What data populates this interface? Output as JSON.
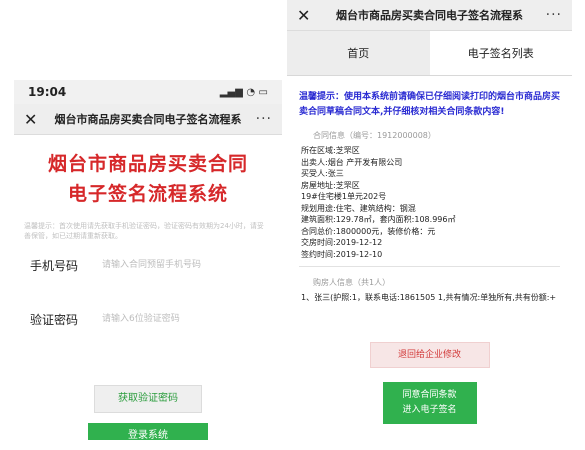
{
  "left": {
    "status_time": "19:04",
    "window_title": "烟台市商品房买卖合同电子签名流程系",
    "hero_line1": "烟台市商品房买卖合同",
    "hero_line2": "电子签名流程系统",
    "tip": "温馨提示：首次使用请先获取手机验证密码，验证密码有效期为24小时，请妥善保管，如已过期请重新获取。",
    "phone_label": "手机号码",
    "phone_placeholder": "请输入合同预留手机号码",
    "code_label": "验证密码",
    "code_placeholder": "请输入6位验证密码",
    "get_code_button": "获取验证密码",
    "login_button": "登录系统"
  },
  "right": {
    "window_title": "烟台市商品房买卖合同电子签名流程系",
    "tab_home": "首页",
    "tab_list": "电子签名列表",
    "warning": "温馨提示：使用本系统前请确保已仔细阅读打印的烟台市商品房买卖合同草稿合同文本,并仔细核对相关合同条款内容!",
    "contract_header": "合同信息（编号：1912000008）",
    "contract_lines": [
      "所在区域:芝罘区",
      "出卖人:烟台                产开发有限公司",
      "买受人:张三",
      "房屋地址:芝罘区",
      "19#住宅楼1单元202号",
      "规划用途:住宅、建筑结构：钢混",
      "建筑面积:129.78㎡，套内面积:108.996㎡",
      "合同总价:1800000元，装修价格：元",
      "交房时间:2019-12-12",
      "签约时间:2019-12-10"
    ],
    "buyer_header": "购房人信息（共1人）",
    "buyer_text": "1、张三(护照:1，联系电话:1861505        1,共有情况:单独所有,共有份额:+",
    "return_button": "退回给企业修改",
    "agree_line1": "同意合同条款",
    "agree_line2": "进入电子签名"
  }
}
